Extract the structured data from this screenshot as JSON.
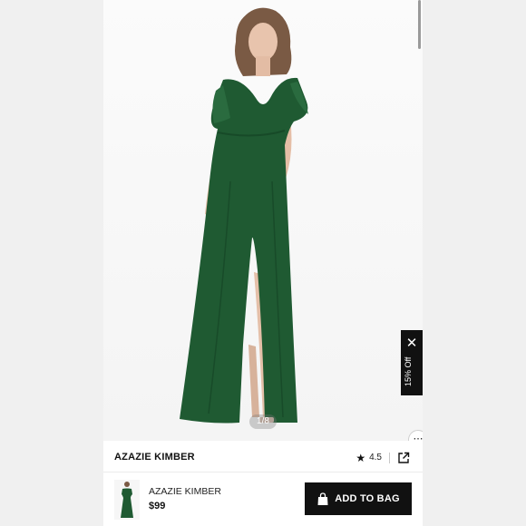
{
  "product": {
    "title": "AZAZIE KIMBER",
    "rating": "4.5",
    "image_counter": "1/8",
    "price": "$99",
    "dress_color": "#1f5a32"
  },
  "promo": {
    "label": "15% Off",
    "close_symbol": "✕"
  },
  "bottom_bar": {
    "item_name": "AZAZIE KIMBER",
    "item_price": "$99",
    "cta_label": "ADD TO BAG"
  },
  "icons": {
    "star": "★",
    "share": "share-icon",
    "bag": "bag-icon",
    "chat": "⋯"
  },
  "colors": {
    "accent": "#111111",
    "background": "#fafafa"
  }
}
